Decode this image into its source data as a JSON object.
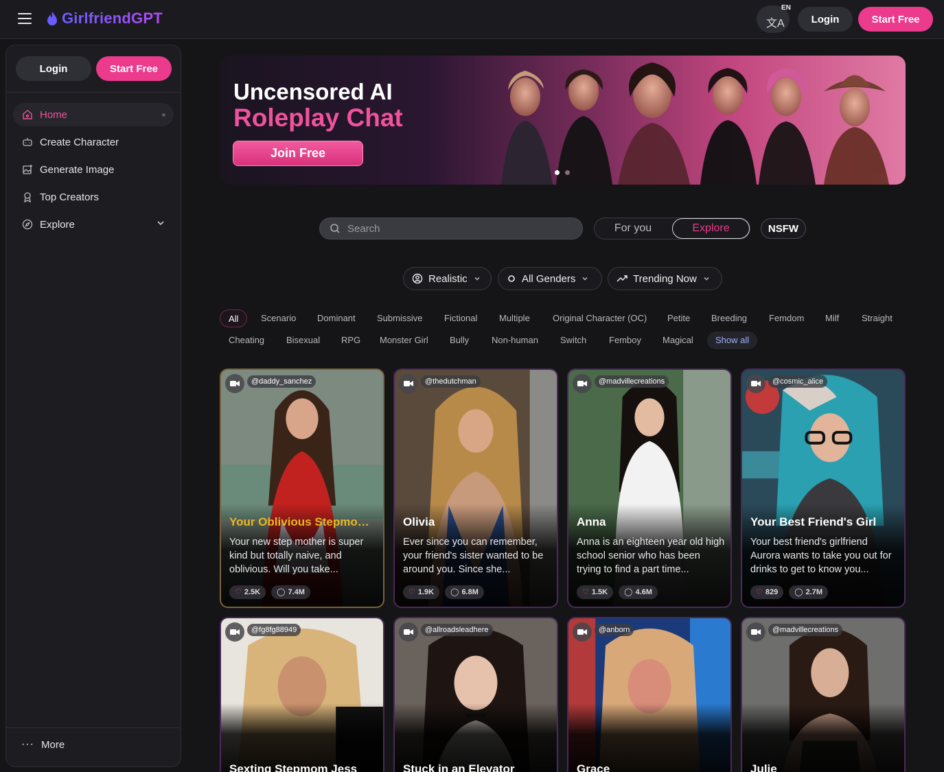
{
  "app": {
    "name": "GirlfriendGPT"
  },
  "topbar": {
    "lang": "EN",
    "login_label": "Login",
    "start_label": "Start Free"
  },
  "sidebar": {
    "login_label": "Login",
    "start_label": "Start Free",
    "items": [
      {
        "label": "Home",
        "icon": "home-icon"
      },
      {
        "label": "Create Character",
        "icon": "robot-icon"
      },
      {
        "label": "Generate Image",
        "icon": "image-plus-icon"
      },
      {
        "label": "Top Creators",
        "icon": "award-icon"
      },
      {
        "label": "Explore",
        "icon": "compass-icon"
      }
    ],
    "more_label": "More"
  },
  "banner": {
    "title_line1": "Uncensored AI",
    "title_line2": "Roleplay Chat",
    "cta_label": "Join Free"
  },
  "search": {
    "placeholder": "Search"
  },
  "feed_toggle": {
    "for_you": "For you",
    "explore": "Explore",
    "nsfw": "NSFW"
  },
  "filters": {
    "style": "Realistic",
    "gender": "All Genders",
    "sort": "Trending Now"
  },
  "tags": {
    "row1": [
      "All",
      "Scenario",
      "Dominant",
      "Submissive",
      "Fictional",
      "Multiple",
      "Original Character (OC)",
      "Petite",
      "Breeding",
      "Femdom",
      "Milf",
      "Straight"
    ],
    "row2": [
      "Cheating",
      "Bisexual",
      "RPG",
      "Monster Girl",
      "Bully",
      "Non-human",
      "Switch",
      "Femboy",
      "Magical",
      "Show all"
    ]
  },
  "cards": [
    {
      "handle": "@daddy_sanchez",
      "title": "Your Oblivious Stepmom ...",
      "desc": "Your new step mother is super kind but totally naive, and oblivious. Will you take...",
      "likes": "2.5K",
      "chats": "7.4M"
    },
    {
      "handle": "@thedutchman",
      "title": "Olivia",
      "desc": "Ever since you can remember, your friend's sister wanted to be around you. Since she...",
      "likes": "1.9K",
      "chats": "6.8M"
    },
    {
      "handle": "@madvillecreations",
      "title": "Anna",
      "desc": "Anna is an eighteen year old high school senior who has been trying to find a part time...",
      "likes": "1.5K",
      "chats": "4.6M"
    },
    {
      "handle": "@cosmic_alice",
      "title": "Your Best Friend's Girl",
      "desc": "Your best friend's girlfriend Aurora wants to take you out for drinks to get to know you...",
      "likes": "829",
      "chats": "2.7M"
    },
    {
      "handle": "@fg8fg88949",
      "title": "Sexting Stepmom Jess",
      "desc": "",
      "likes": "",
      "chats": ""
    },
    {
      "handle": "@allroadsleadhere",
      "title": "Stuck in an Elevator",
      "desc": "",
      "likes": "",
      "chats": ""
    },
    {
      "handle": "@anborn",
      "title": "Grace",
      "desc": "",
      "likes": "",
      "chats": ""
    },
    {
      "handle": "@madvillecreations",
      "title": "Julie",
      "desc": "",
      "likes": "",
      "chats": ""
    }
  ]
}
